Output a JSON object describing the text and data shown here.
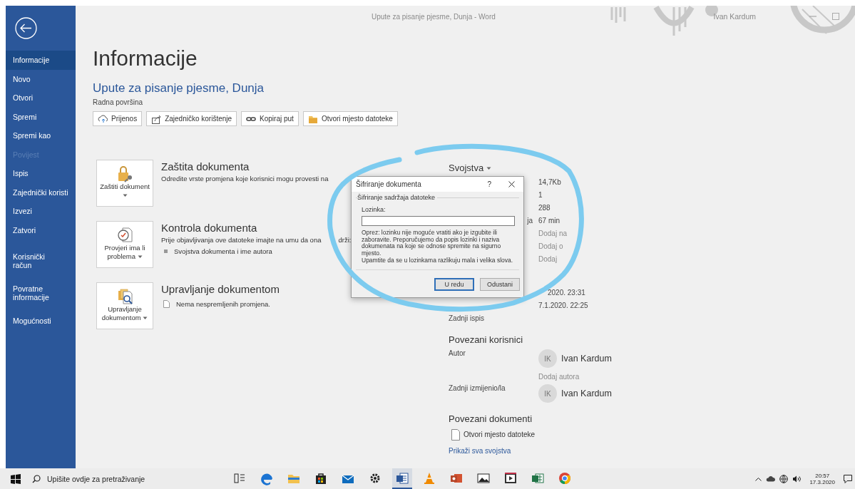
{
  "window": {
    "title": "Upute za pisanje pjesme, Dunja  -  Word",
    "account": "Ivan Kardum"
  },
  "sidebar": {
    "items": [
      {
        "label": "Informacije",
        "selected": true,
        "disabled": false
      },
      {
        "label": "Novo",
        "selected": false,
        "disabled": false
      },
      {
        "label": "Otvori",
        "selected": false,
        "disabled": false
      },
      {
        "label": "Spremi",
        "selected": false,
        "disabled": false
      },
      {
        "label": "Spremi kao",
        "selected": false,
        "disabled": false
      },
      {
        "label": "Povijest",
        "selected": false,
        "disabled": true
      },
      {
        "label": "Ispis",
        "selected": false,
        "disabled": false
      },
      {
        "label": "Zajednički koristi",
        "selected": false,
        "disabled": false
      },
      {
        "label": "Izvezi",
        "selected": false,
        "disabled": false
      },
      {
        "label": "Zatvori",
        "selected": false,
        "disabled": false
      }
    ],
    "footer_items": [
      {
        "label": "Korisnički račun",
        "selected": false
      },
      {
        "label": "Povratne informacije",
        "selected": false
      },
      {
        "label": "Mogućnosti",
        "selected": false
      }
    ]
  },
  "page": {
    "heading": "Informacije",
    "document_title": "Upute za pisanje pjesme, Dunja",
    "location": "Radna površina",
    "actions": [
      {
        "kind": "upload",
        "label": "Prijenos"
      },
      {
        "kind": "share",
        "label": "Zajedničko korištenje"
      },
      {
        "kind": "link",
        "label": "Kopiraj put"
      },
      {
        "kind": "folder",
        "label": "Otvori mjesto datoteke"
      }
    ]
  },
  "sections": [
    {
      "kind": "protect",
      "button": "Zaštiti dokument",
      "title": "Zaštita dokumenta",
      "text": "Odredite vrste promjena koje korisnici mogu provesti na"
    },
    {
      "kind": "inspect",
      "button": "Provjeri ima li problema",
      "title": "Kontrola dokumenta",
      "text": "Prije objavljivanja ove datoteke imajte na umu da ona",
      "text_tail": "drži:",
      "bullets": [
        "Svojstva dokumenta i ime autora"
      ]
    },
    {
      "kind": "manage",
      "button": "Upravljanje dokumentom",
      "title": "Upravljanje dokumentom",
      "notes": [
        "Nema nespremljenih promjena."
      ]
    }
  ],
  "properties": {
    "heading": "Svojstva",
    "rows": [
      {
        "kind": "value",
        "value": "14,7Kb"
      },
      {
        "kind": "value",
        "value": "1"
      },
      {
        "kind": "value",
        "value": "288"
      },
      {
        "kind": "value",
        "label": "ja",
        "clipped": true,
        "value": "67 min"
      },
      {
        "kind": "hint",
        "value": "Dodaj na"
      },
      {
        "kind": "hint",
        "value": "Dodaj o"
      },
      {
        "kind": "hint",
        "value": "Dodaj"
      }
    ],
    "dates": [
      {
        "value": "2020. 23:31",
        "clipped": true
      },
      {
        "value": "7.1.2020. 22:25",
        "clipped": false
      },
      {
        "label": "Zadnji ispis"
      }
    ]
  },
  "related_people": {
    "heading": "Povezani korisnici",
    "rows": [
      {
        "label": "Autor",
        "people": [
          {
            "initials": "IK",
            "name": "Ivan Kardum"
          }
        ],
        "add": "Dodaj autora"
      },
      {
        "label": "Zadnji izmijenio/la",
        "people": [
          {
            "initials": "IK",
            "name": "Ivan Kardum"
          }
        ]
      }
    ]
  },
  "related_documents": {
    "heading": "Povezani dokumenti",
    "items": [
      "Otvori mjesto datoteke"
    ],
    "link": "Prikaži sva svojstva"
  },
  "dialog": {
    "title": "Šifriranje dokumenta",
    "help": "?",
    "group": "Šifriranje sadržaja datoteke",
    "field_label": "Lozinka:",
    "warning": "Oprez: lozinku nije moguće vratiti ako je izgubite ili zaboravite. Preporučujemo da popis lozinki i naziva dokumenata na koje se odnose spremite na sigurno mjesto.",
    "note": "Upamtite da se u lozinkama razlikuju mala i velika slova.",
    "buttons": [
      {
        "label": "U redu",
        "default": true
      },
      {
        "label": "Odustani",
        "default": false
      }
    ]
  },
  "taskbar": {
    "search_placeholder": "Upišite ovdje za pretraživanje",
    "apps": [
      {
        "kind": "taskview",
        "selected": false
      },
      {
        "kind": "edge",
        "selected": false
      },
      {
        "kind": "explorer",
        "selected": false
      },
      {
        "kind": "store",
        "selected": false
      },
      {
        "kind": "mail",
        "selected": false
      },
      {
        "kind": "settings",
        "selected": false
      },
      {
        "kind": "word",
        "selected": true
      },
      {
        "kind": "vlc",
        "selected": false
      },
      {
        "kind": "powerpoint",
        "selected": false
      },
      {
        "kind": "photos",
        "selected": false
      },
      {
        "kind": "video",
        "selected": false
      },
      {
        "kind": "excel",
        "selected": false
      },
      {
        "kind": "chrome",
        "selected": false
      }
    ],
    "time": "20:57",
    "date": "17.3.2020"
  }
}
